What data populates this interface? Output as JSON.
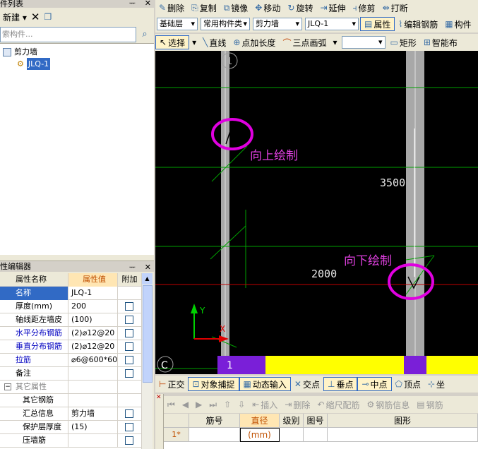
{
  "component_list": {
    "title": "构件列表",
    "title_visible": "件列表",
    "new_label": "新建",
    "search_placeholder": "搜索构件...",
    "search_placeholder_visible": "索构件...",
    "tree": {
      "root": "剪力墙",
      "child": "JLQ-1"
    }
  },
  "property_editor": {
    "title": "属性编辑器",
    "title_visible": "性编辑器",
    "headers": {
      "name": "属性名称",
      "value": "属性值",
      "extra": "附加"
    },
    "rows": [
      {
        "name": "名称",
        "value": "JLQ-1"
      },
      {
        "name": "厚度(mm)",
        "value": "200"
      },
      {
        "name": "轴线距左墙皮",
        "value": "(100)"
      },
      {
        "name": "水平分布钢筋",
        "value": "(2)⌀12@20"
      },
      {
        "name": "垂直分布钢筋",
        "value": "(2)⌀12@20"
      },
      {
        "name": "拉筋",
        "value": "⌀6@600*60"
      },
      {
        "name": "备注",
        "value": ""
      },
      {
        "name": "其它属性",
        "value": ""
      },
      {
        "name": "其它钢筋",
        "value": ""
      },
      {
        "name": "汇总信息",
        "value": "剪力墙"
      },
      {
        "name": "保护层厚度",
        "value": "(15)"
      },
      {
        "name": "压墙筋",
        "value": ""
      }
    ]
  },
  "toolbar1": [
    "删除",
    "复制",
    "镜像",
    "移动",
    "旋转",
    "延伸",
    "修剪",
    "打断"
  ],
  "toolbar2": {
    "layer": "基础层",
    "type": "常用构件类",
    "component": "剪力墙",
    "name": "JLQ-1",
    "buttons": [
      "属性",
      "编辑钢筋",
      "构件"
    ]
  },
  "toolbar3": [
    "选择",
    "直线",
    "点加长度",
    "三点画弧",
    "矩形",
    "智能布"
  ],
  "canvas": {
    "axis_top": "1",
    "axis_bottom": "1",
    "axis_left": "C",
    "up_label": "向上绘制",
    "down_label": "向下绘制",
    "dim_vertical": "3500",
    "dim_horizontal": "2000",
    "axis_y": "Y",
    "axis_x": "X",
    "colors": {
      "pink": "#e000e0",
      "green": "#00a000",
      "yellow": "#ffff00",
      "purple": "#7a1fd8"
    }
  },
  "snap": [
    "正交",
    "对象捕捉",
    "动态输入",
    "交点",
    "垂点",
    "中点",
    "顶点",
    "坐"
  ],
  "rebar_toolbar": [
    "插入",
    "删除",
    "缩尺配筋",
    "钢筋信息",
    "钢筋"
  ],
  "rebar_grid": {
    "headers": [
      "筋号",
      "直径(mm)",
      "级别",
      "图号",
      "图形"
    ],
    "row_label": "1*"
  }
}
